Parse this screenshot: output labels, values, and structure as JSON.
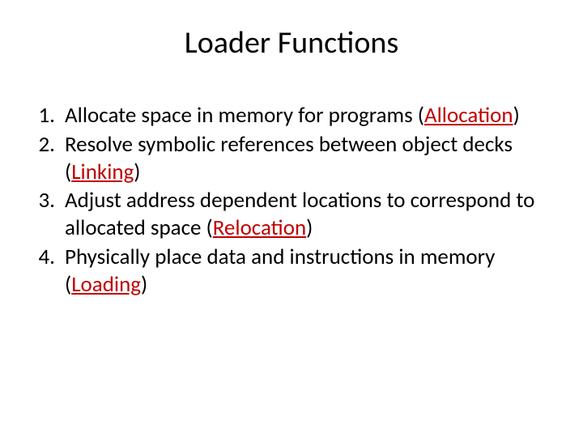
{
  "title": "Loader Functions",
  "items": [
    {
      "number": "1.",
      "before": "Allocate space in memory for programs (",
      "keyword": "Allocation",
      "after": ")"
    },
    {
      "number": "2.",
      "before": "Resolve symbolic references between object decks (",
      "keyword": "Linking",
      "after": ")"
    },
    {
      "number": "3.",
      "before": "Adjust address dependent locations to correspond to allocated space (",
      "keyword": "Relocation",
      "after": ")"
    },
    {
      "number": "4.",
      "before": "Physically place data and instructions in memory (",
      "keyword": "Loading",
      "after": ")"
    }
  ]
}
